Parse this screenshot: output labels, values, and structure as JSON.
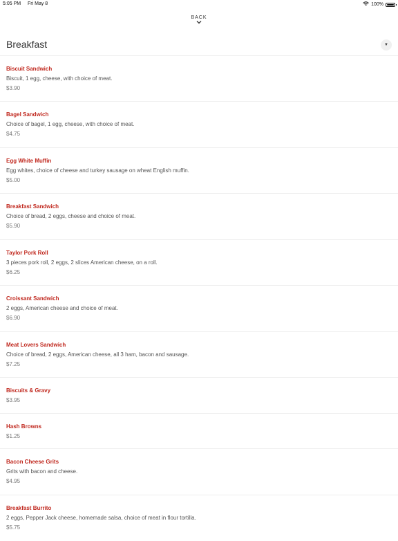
{
  "status": {
    "time": "5:05 PM",
    "date": "Fri May 8",
    "battery": "100%"
  },
  "nav": {
    "back_label": "BACK"
  },
  "header": {
    "title": "Breakfast"
  },
  "items": [
    {
      "name": "Biscuit Sandwich",
      "desc": "Biscuit, 1 egg, cheese, with choice of meat.",
      "price": "$3.90"
    },
    {
      "name": "Bagel Sandwich",
      "desc": "Choice of bagel, 1 egg, cheese, with choice of meat.",
      "price": "$4.75"
    },
    {
      "name": "Egg White Muffin",
      "desc": "Egg whites, choice of cheese and turkey sausage on wheat English muffin.",
      "price": "$5.00"
    },
    {
      "name": "Breakfast Sandwich",
      "desc": "Choice of bread, 2 eggs, cheese and choice of meat.",
      "price": "$5.90"
    },
    {
      "name": "Taylor Pork Roll",
      "desc": "3 pieces pork roll, 2 eggs, 2 slices American cheese, on a roll.",
      "price": "$6.25"
    },
    {
      "name": "Croissant Sandwich",
      "desc": "2 eggs, American cheese and choice of meat.",
      "price": "$6.90"
    },
    {
      "name": "Meat Lovers Sandwich",
      "desc": "Choice of bread, 2 eggs, American cheese, all 3 ham, bacon and sausage.",
      "price": "$7.25"
    },
    {
      "name": "Biscuits & Gravy",
      "price": "$3.95"
    },
    {
      "name": "Hash Browns",
      "price": "$1.25"
    },
    {
      "name": "Bacon Cheese Grits",
      "desc": "Grits with bacon and cheese.",
      "price": "$4.95"
    },
    {
      "name": "Breakfast Burrito",
      "desc": "2 eggs, Pepper Jack cheese, homemade salsa, choice of meat in flour tortilla.",
      "price": "$5.75"
    }
  ]
}
